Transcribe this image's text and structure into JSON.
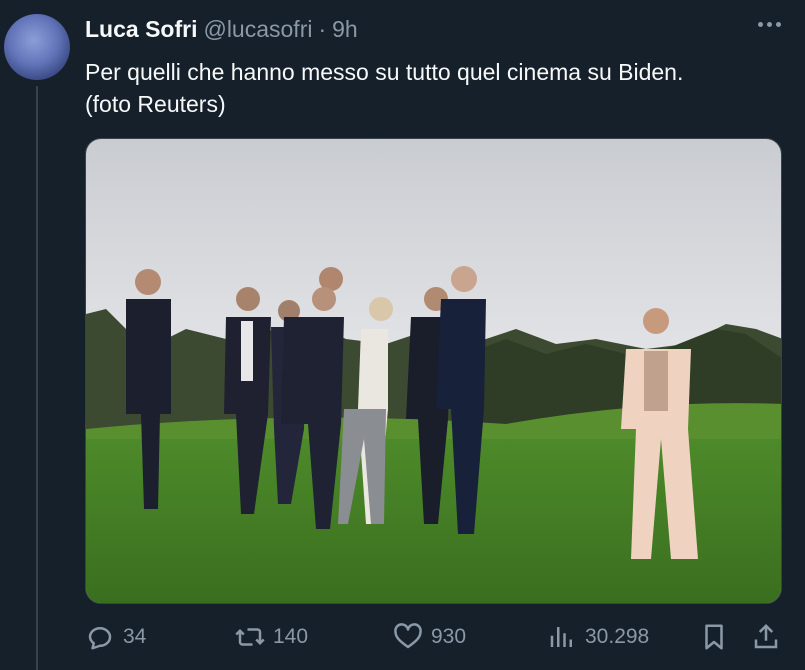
{
  "author": {
    "name": "Luca Sofri",
    "handle": "@lucasofri",
    "separator": "·",
    "time": "9h"
  },
  "tweet": {
    "line1": "Per quelli che hanno messo su tutto quel cinema su Biden.",
    "line2": "(foto Reuters)"
  },
  "actions": {
    "replies": "34",
    "reposts": "140",
    "likes": "930",
    "views": "30.298"
  },
  "icons": {
    "more": "more-icon",
    "reply": "reply-icon",
    "repost": "repost-icon",
    "like": "heart-icon",
    "views": "views-icon",
    "bookmark": "bookmark-icon",
    "share": "share-icon"
  },
  "colors": {
    "background": "#15202b",
    "text_primary": "#f7f9f9",
    "text_secondary": "#8b98a5",
    "divider": "#38444d"
  }
}
